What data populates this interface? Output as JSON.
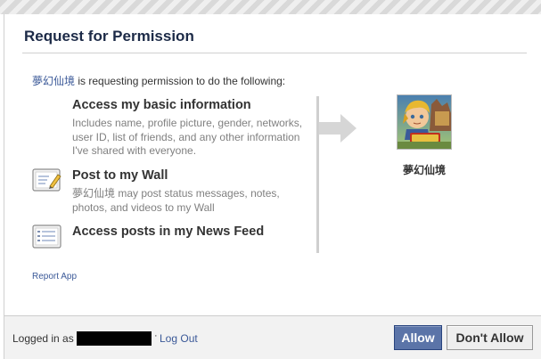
{
  "dialog": {
    "title": "Request for Permission"
  },
  "intro": {
    "app_name": "夢幻仙境",
    "text": " is requesting permission to do the following:"
  },
  "permissions": [
    {
      "title": "Access my basic information",
      "description": "Includes name, profile picture, gender, networks, user ID, list of friends, and any other information I've shared with everyone.",
      "icon": "none"
    },
    {
      "title": "Post to my Wall",
      "description": "夢幻仙境 may post status messages, notes, photos, and videos to my Wall",
      "icon": "wall-post-icon"
    },
    {
      "title": "Access posts in my News Feed",
      "description": "",
      "icon": "news-feed-icon"
    }
  ],
  "app": {
    "name": "夢幻仙境",
    "icon": "game-avatar-icon"
  },
  "links": {
    "report_app": "Report App"
  },
  "footer": {
    "logged_in_prefix": "Logged in as",
    "separator": "·",
    "logout": "Log Out",
    "allow": "Allow",
    "dont_allow": "Don't Allow"
  },
  "colors": {
    "title": "#1c2a47",
    "link": "#3b5998",
    "allow_button": "#5b74a8",
    "footer_bg": "#f2f2f2"
  }
}
